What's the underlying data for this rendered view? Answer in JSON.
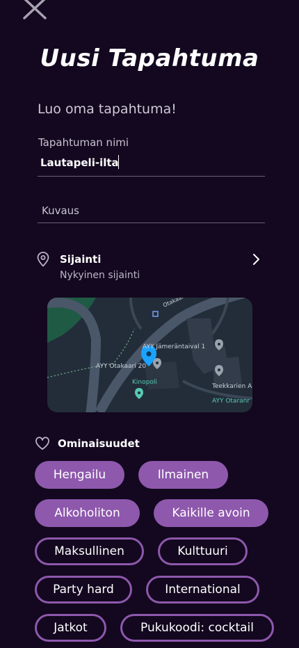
{
  "header": {
    "title": "Uusi Tapahtuma",
    "close_icon": "close-icon"
  },
  "form": {
    "subtitle": "Luo oma tapahtuma!",
    "name_label": "Tapahtuman nimi",
    "name_value": "Lautapeli-ilta",
    "description_placeholder": "Kuvaus"
  },
  "location": {
    "title": "Sijainti",
    "subtitle": "Nykyinen sijainti",
    "map": {
      "labels": [
        "Otakaari",
        "AYY Jämeräntaival 1",
        "AYY Otakaari 20",
        "Kinopoli",
        "Teekkarien A",
        "AYY Otaranr"
      ],
      "accent_pin": "#1aa3ff"
    }
  },
  "features": {
    "title": "Ominaisuudet",
    "tags": [
      {
        "label": "Hengailu",
        "selected": true
      },
      {
        "label": "Ilmainen",
        "selected": true
      },
      {
        "label": "Alkoholiton",
        "selected": true
      },
      {
        "label": "Kaikille avoin",
        "selected": true
      },
      {
        "label": "Maksullinen",
        "selected": false
      },
      {
        "label": "Kulttuuri",
        "selected": false
      },
      {
        "label": "Party hard",
        "selected": false
      },
      {
        "label": "International",
        "selected": false
      },
      {
        "label": "Jatkot",
        "selected": false
      },
      {
        "label": "Pukukoodi: cocktail",
        "selected": false
      }
    ]
  },
  "colors": {
    "background": "#13081f",
    "accent": "#8e58ad",
    "text": "#ffffff"
  }
}
